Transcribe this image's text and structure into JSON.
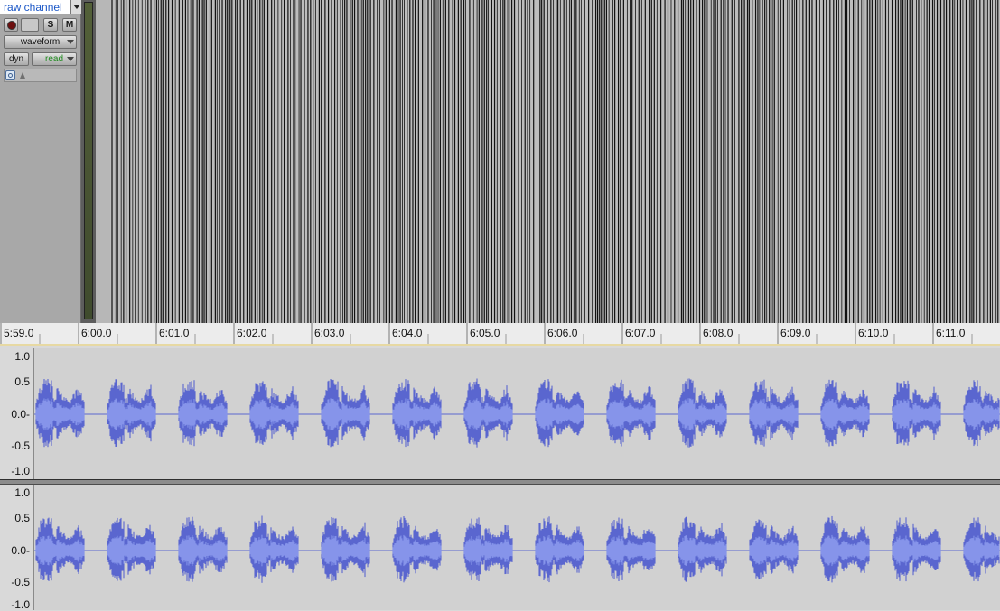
{
  "track": {
    "name": "raw channel",
    "solo_label": "S",
    "mute_label": "M",
    "view_label": "waveform",
    "dyn_label": "dyn",
    "automation_label": "read"
  },
  "ruler": {
    "labels": [
      "5:59.0",
      "6:00.0",
      "6:01.0",
      "6:02.0",
      "6:03.0",
      "6:04.0",
      "6:05.0",
      "6:06.0",
      "6:07.0",
      "6:08.0",
      "6:09.0",
      "6:10.0",
      "6:11.0"
    ]
  },
  "channels": [
    {
      "y_labels": [
        "1.0",
        "0.5",
        "0.0-",
        "-0.5",
        "-1.0"
      ]
    },
    {
      "y_labels": [
        "1.0",
        "0.5",
        "0.0-",
        "-0.5",
        "-1.0"
      ]
    }
  ],
  "colors": {
    "waveform_fill": "#5a67cf",
    "waveform_center": "#8897eb",
    "pulse_line": "#111111",
    "track_name": "#1b57c7"
  },
  "icons": {
    "record": "record-icon",
    "dropdown": "chevron-down-icon",
    "voice": "voice-icon",
    "input": "triangle-icon"
  }
}
